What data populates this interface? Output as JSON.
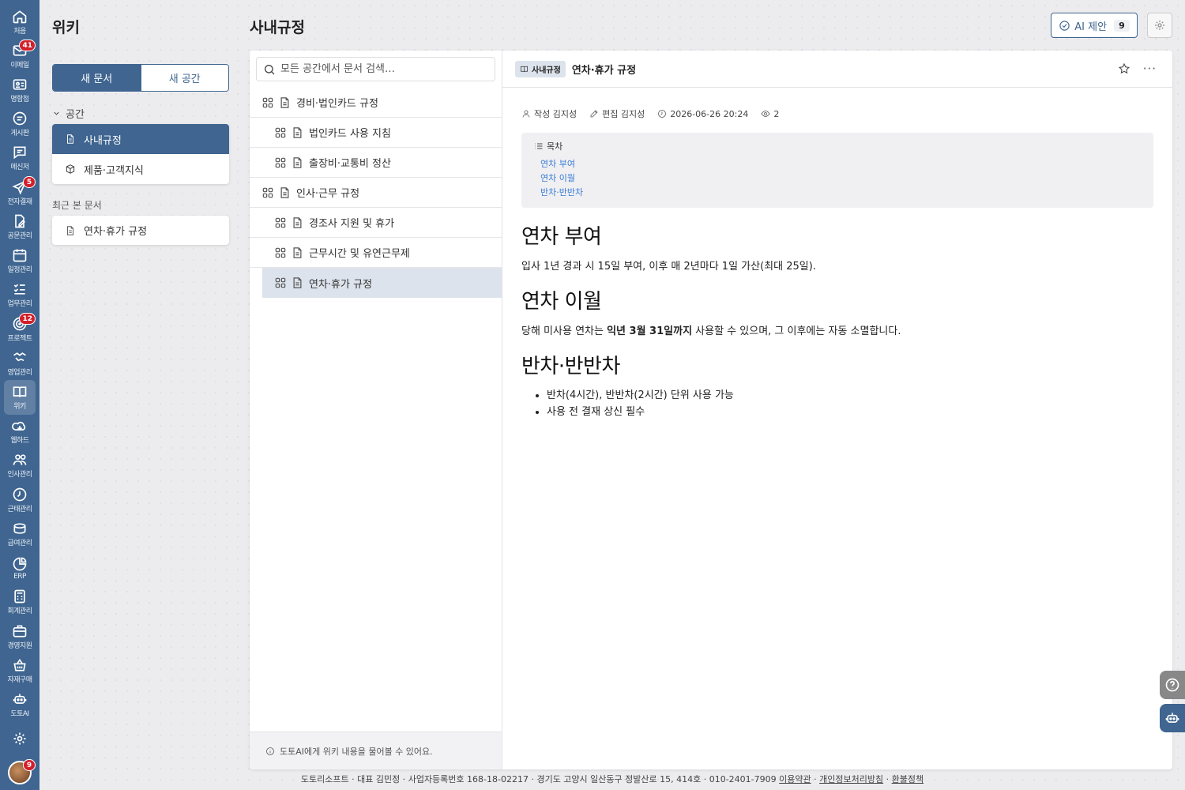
{
  "rail": [
    {
      "label": "처음",
      "icon": "home-icon",
      "badge": ""
    },
    {
      "label": "이메일",
      "icon": "mail-icon",
      "badge": "41"
    },
    {
      "label": "명함첩",
      "icon": "card-icon",
      "badge": ""
    },
    {
      "label": "게시판",
      "icon": "board-icon",
      "badge": ""
    },
    {
      "label": "메신저",
      "icon": "messenger-icon",
      "badge": ""
    },
    {
      "label": "전자결재",
      "icon": "approval-icon",
      "badge": "5"
    },
    {
      "label": "공문관리",
      "icon": "document-edit-icon",
      "badge": ""
    },
    {
      "label": "일정관리",
      "icon": "calendar-icon",
      "badge": ""
    },
    {
      "label": "업무관리",
      "icon": "tasks-icon",
      "badge": ""
    },
    {
      "label": "프로젝트",
      "icon": "target-icon",
      "badge": "12"
    },
    {
      "label": "영업관리",
      "icon": "handshake-icon",
      "badge": ""
    },
    {
      "label": "위키",
      "icon": "book-icon",
      "badge": ""
    },
    {
      "label": "웹하드",
      "icon": "cloud-icon",
      "badge": ""
    },
    {
      "label": "인사관리",
      "icon": "people-icon",
      "badge": ""
    },
    {
      "label": "근태관리",
      "icon": "clock-icon",
      "badge": ""
    },
    {
      "label": "급여관리",
      "icon": "coins-icon",
      "badge": ""
    },
    {
      "label": "ERP",
      "icon": "pie-icon",
      "badge": ""
    },
    {
      "label": "회계관리",
      "icon": "calculator-icon",
      "badge": ""
    },
    {
      "label": "경영지원",
      "icon": "briefcase-icon",
      "badge": ""
    },
    {
      "label": "자재구매",
      "icon": "basket-icon",
      "badge": ""
    },
    {
      "label": "도토AI",
      "icon": "robot-icon",
      "badge": ""
    }
  ],
  "rail_bottom": {
    "avatar_badge": "9"
  },
  "wiki": {
    "title": "위키",
    "new_doc": "새 문서",
    "new_space": "새 공간",
    "space_head": "공간",
    "spaces": [
      "사내규정",
      "제품·고객지식"
    ],
    "recent_head": "최근 본 문서",
    "recent": [
      "연차·휴가 규정"
    ]
  },
  "page": {
    "title": "사내규정",
    "ai_label": "AI 제안",
    "ai_count": "9"
  },
  "tree": {
    "search_placeholder": "모든 공간에서 문서 검색…",
    "rows": [
      {
        "label": "경비·법인카드 규정",
        "level": 0
      },
      {
        "label": "법인카드 사용 지침",
        "level": 1
      },
      {
        "label": "출장비·교통비 정산",
        "level": 1
      },
      {
        "label": "인사·근무 규정",
        "level": 0
      },
      {
        "label": "경조사 지원 및 휴가",
        "level": 1
      },
      {
        "label": "근무시간 및 유연근무제",
        "level": 1
      },
      {
        "label": "연차·휴가 규정",
        "level": 1
      }
    ],
    "footer": "도토AI에게 위키 내용을 물어볼 수 있어요."
  },
  "doc": {
    "crumb": "사내규정",
    "title": "연차·휴가 규정",
    "author": "작성 김지성",
    "editor": "편집 김지성",
    "date": "2026-06-26 20:24",
    "views": "2",
    "toc_head": "목차",
    "toc": [
      "연차 부여",
      "연차 이월",
      "반차·반반차"
    ],
    "s1_title": "연차 부여",
    "s1_text": "입사 1년 경과 시 15일 부여, 이후 매 2년마다 1일 가산(최대 25일).",
    "s2_title": "연차 이월",
    "s2_pre": "당해 미사용 연차는 ",
    "s2_bold": "익년 3월 31일까지",
    "s2_post": " 사용할 수 있으며, 그 이후에는 자동 소멸합니다.",
    "s3_title": "반차·반반차",
    "s3_items": [
      "반차(4시간), 반반차(2시간) 단위 사용 가능",
      "사용 전 결재 상신 필수"
    ]
  },
  "footer": {
    "text": "도토리소프트 · 대표 김민정 · 사업자등록번호 168-18-02217 · 경기도 고양시 일산동구 정발산로 15, 414호 · 010-2401-7909 ",
    "terms": "이용약관",
    "privacy": "개인정보처리방침",
    "refund": "환불정책",
    "sep": " · "
  }
}
